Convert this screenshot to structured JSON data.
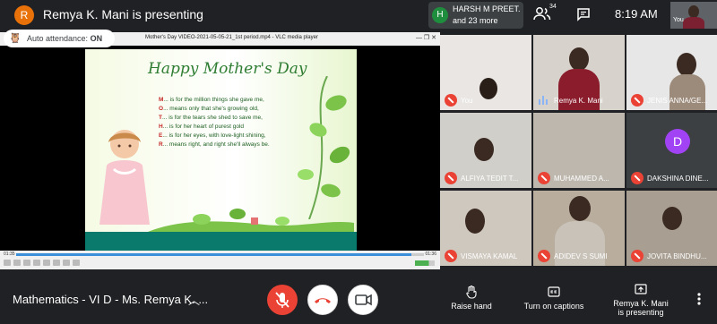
{
  "topbar": {
    "presenter_initial": "R",
    "presenting_title": "Remya K. Mani is presenting",
    "participant_initial": "H",
    "participant_name": "HARSH M PREET...",
    "participant_more": "and 23 more",
    "people_count": "34",
    "clock": "8:19 AM",
    "self_label": "You"
  },
  "auto_attendance": {
    "label": "Auto attendance:",
    "status": "ON"
  },
  "shared_window": {
    "title": "Mother's Day VIDEO-2021-05-05-21_1st period.mp4 - VLC media player",
    "controls": "—  ❐  ✕",
    "time_left": "01:35",
    "time_right": "01:36",
    "progress": 0.97
  },
  "card": {
    "title": "Happy Mother's Day",
    "lines": [
      {
        "cap": "M",
        "text": "... is for the million things she gave me,"
      },
      {
        "cap": "O",
        "text": "... means only that she's growing old,"
      },
      {
        "cap": "T",
        "text": "... is for the tears she shed to save me,"
      },
      {
        "cap": "H",
        "text": "... is for her heart of purest gold"
      },
      {
        "cap": "E",
        "text": "... is for her eyes, with love-light shining,"
      },
      {
        "cap": "R",
        "text": "... means right, and right she'll always be."
      }
    ]
  },
  "participants": [
    {
      "name": "You",
      "state": "muted"
    },
    {
      "name": "Remya K. Mani",
      "state": "speaking"
    },
    {
      "name": "JENIS ANNA/GE...",
      "state": "muted"
    },
    {
      "name": "ALFIYA TEDIT T...",
      "state": "muted"
    },
    {
      "name": "MUHAMMED A...",
      "state": "muted"
    },
    {
      "name": "DAKSHINA DINE...",
      "state": "muted",
      "initial": "D"
    },
    {
      "name": "VISMAYA KAMAL",
      "state": "muted"
    },
    {
      "name": "ADIDEV S SUMI",
      "state": "muted"
    },
    {
      "name": "JOVITA BINDHU...",
      "state": "muted"
    }
  ],
  "bottombar": {
    "meeting_name": "Mathematics - VI D - Ms. Remya K. ...",
    "raise_hand": "Raise hand",
    "captions": "Turn on captions",
    "presenting_line1": "Remya K. Mani",
    "presenting_line2": "is presenting"
  },
  "colors": {
    "mic_off": "#ea4335",
    "background": "#202124",
    "tile": "#3c4043"
  }
}
